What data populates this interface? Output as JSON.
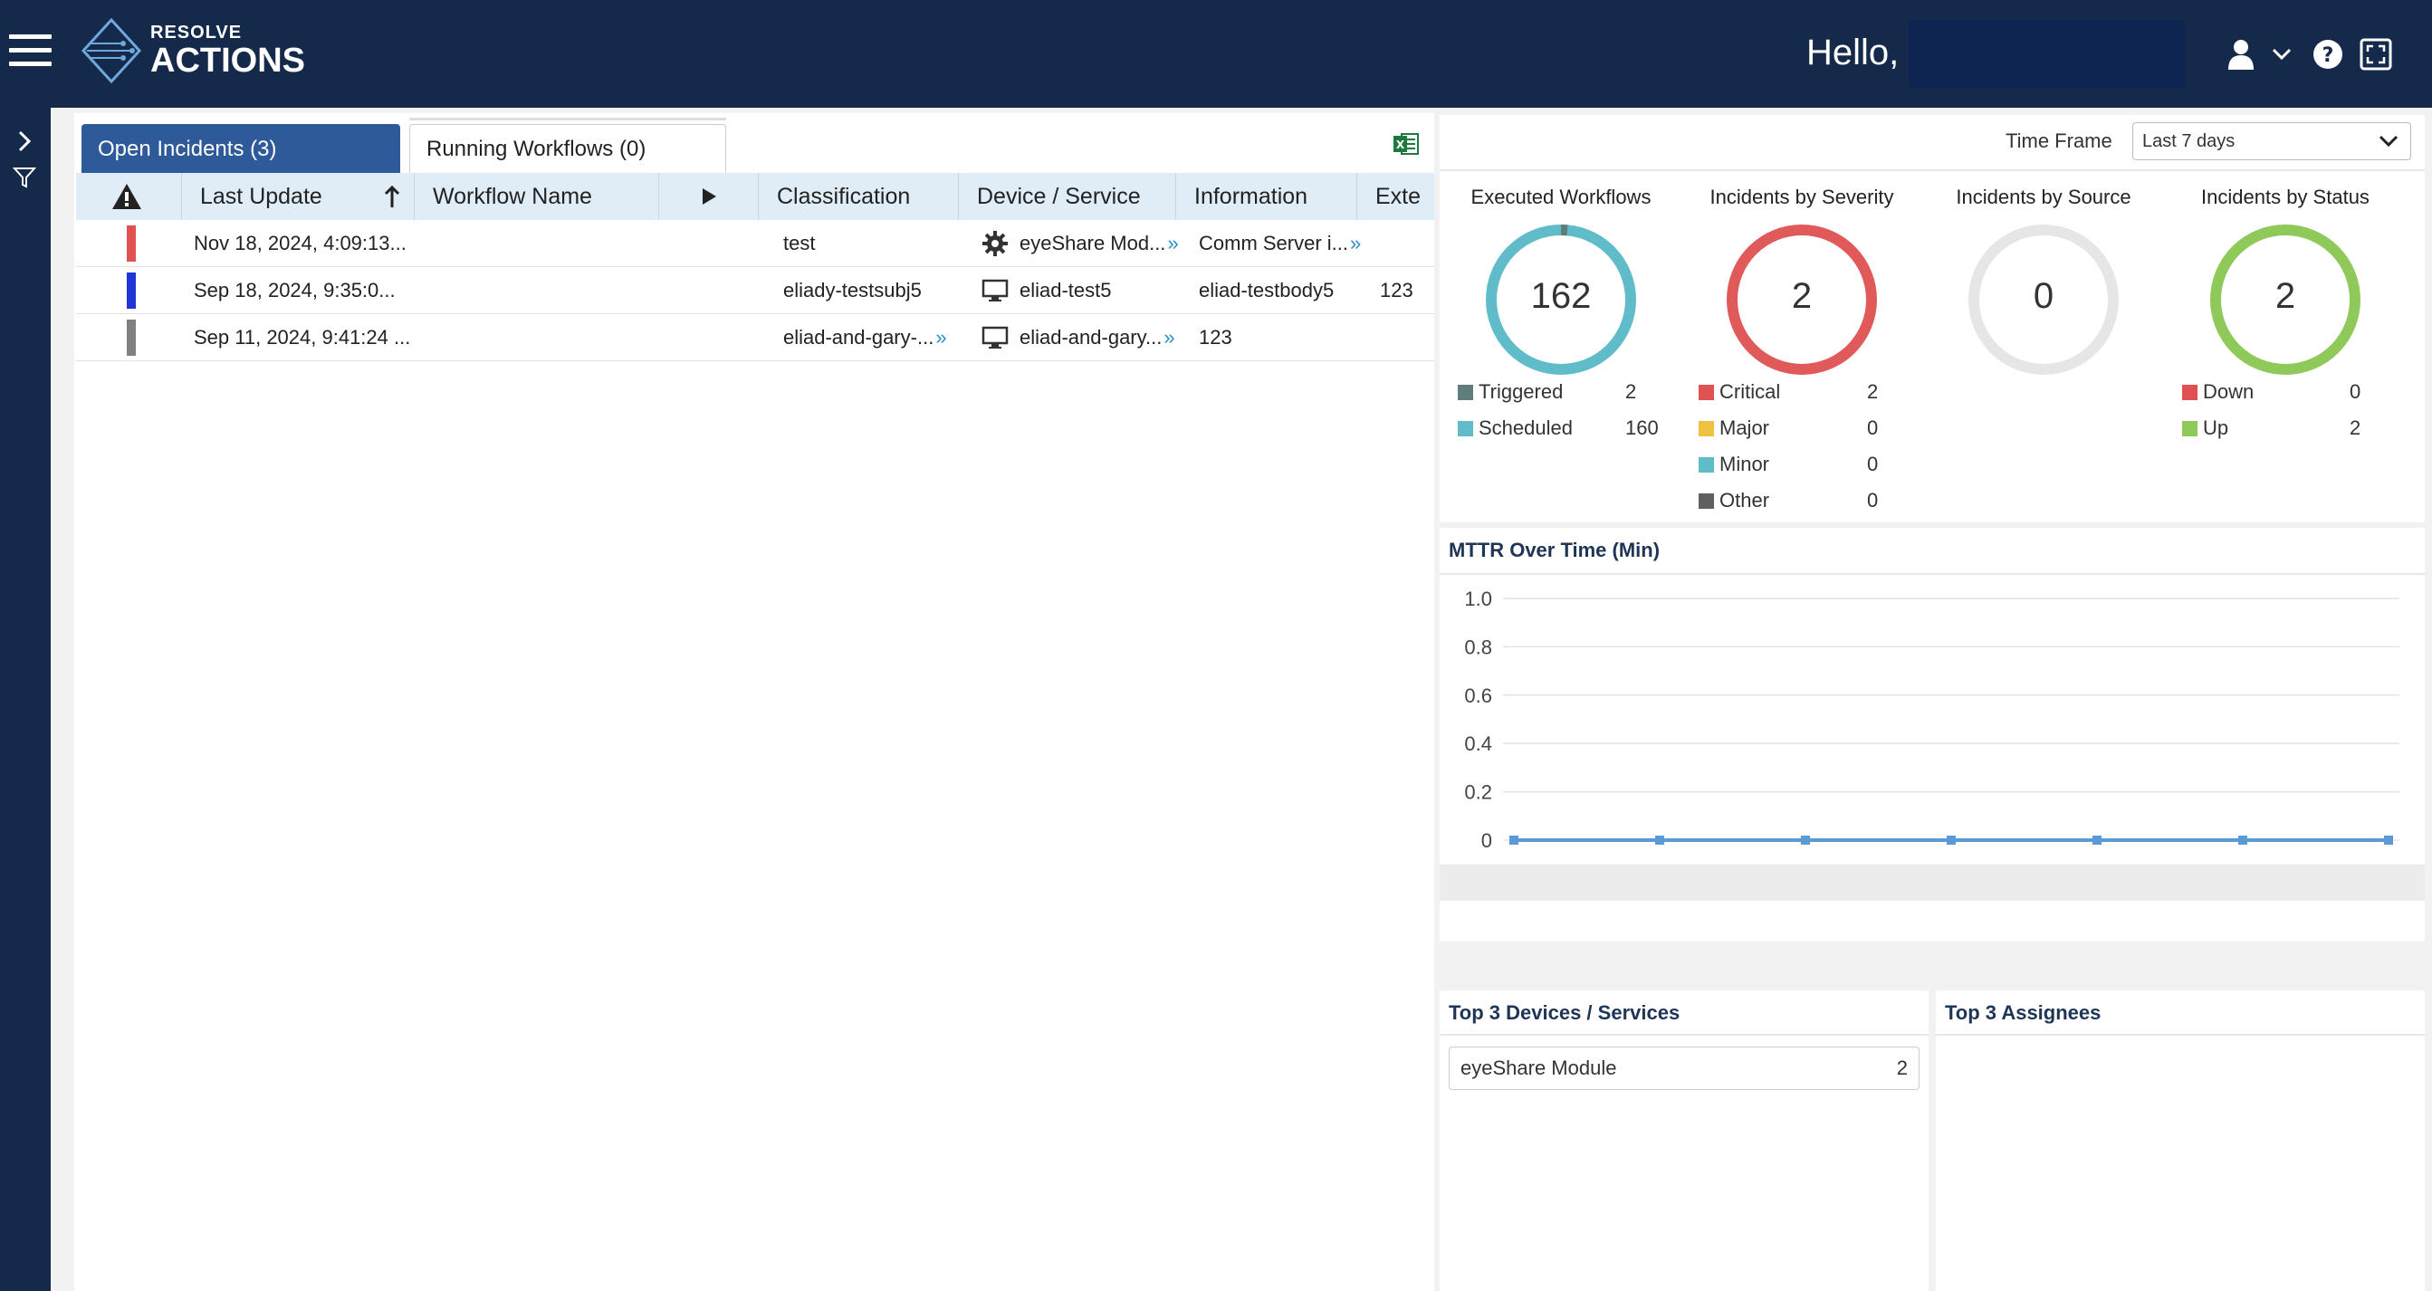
{
  "header": {
    "logo_line1": "RESOLVE",
    "logo_line2": "ACTIONS",
    "greeting": "Hello,"
  },
  "icons": {
    "menu": "hamburger-icon",
    "user": "user-icon",
    "caret": "chevron-down-icon",
    "help": "help-icon",
    "fullscreen": "fullscreen-icon",
    "expand": "chevron-right-icon",
    "filter": "filter-icon",
    "excel": "excel-icon",
    "severity": "warning-icon",
    "sort": "sort-up-icon",
    "run": "play-icon",
    "gear": "gear-icon",
    "monitor": "monitor-icon"
  },
  "tabs": {
    "open_incidents": "Open Incidents (3)",
    "running_workflows": "Running Workflows (0)"
  },
  "grid": {
    "columns": {
      "last_update": "Last Update",
      "workflow_name": "Workflow Name",
      "classification": "Classification",
      "device_service": "Device / Service",
      "information": "Information",
      "external": "Exte"
    },
    "rows": [
      {
        "severity_color": "#e05252",
        "last_update": "Nov 18, 2024, 4:09:13...",
        "workflow_name": "",
        "classification": "test",
        "device_icon": "gear-icon",
        "device": "eyeShare Mod...",
        "information": "Comm Server i...",
        "external": ""
      },
      {
        "severity_color": "#1f35d6",
        "last_update": "Sep 18, 2024, 9:35:0...",
        "workflow_name": "",
        "classification": "eliady-testsubj5",
        "device_icon": "monitor-icon",
        "device": "eliad-test5",
        "information": "eliad-testbody5",
        "external": "123"
      },
      {
        "severity_color": "#808080",
        "last_update": "Sep 11, 2024, 9:41:24 ...",
        "workflow_name": "",
        "classification": "eliad-and-gary-...",
        "device_icon": "monitor-icon",
        "device": "eliad-and-gary...",
        "information": "123",
        "external": ""
      }
    ]
  },
  "time_frame": {
    "label": "Time Frame",
    "value": "Last 7 days"
  },
  "cards": [
    {
      "title": "Executed Workflows",
      "total": "162",
      "ring_color": "#5fbcc8",
      "legend": [
        {
          "label": "Triggered",
          "value": "2",
          "color": "#607d7d"
        },
        {
          "label": "Scheduled",
          "value": "160",
          "color": "#5fbcc8"
        }
      ]
    },
    {
      "title": "Incidents by Severity",
      "total": "2",
      "ring_color": "#e05a5a",
      "legend": [
        {
          "label": "Critical",
          "value": "2",
          "color": "#e05252"
        },
        {
          "label": "Major",
          "value": "0",
          "color": "#f0c040"
        },
        {
          "label": "Minor",
          "value": "0",
          "color": "#5fbcc8"
        },
        {
          "label": "Other",
          "value": "0",
          "color": "#606060"
        }
      ]
    },
    {
      "title": "Incidents by Source",
      "total": "0",
      "ring_color": "#e6e6e6",
      "legend": []
    },
    {
      "title": "Incidents by Status",
      "total": "2",
      "ring_color": "#8ec95a",
      "legend": [
        {
          "label": "Down",
          "value": "0",
          "color": "#e05252"
        },
        {
          "label": "Up",
          "value": "2",
          "color": "#8ec95a"
        }
      ]
    }
  ],
  "mttr": {
    "title": "MTTR Over Time (Min)"
  },
  "chart_data": {
    "type": "line",
    "title": "MTTR Over Time (Min)",
    "y_ticks": [
      "1.0",
      "0.8",
      "0.6",
      "0.4",
      "0.2",
      "0"
    ],
    "ylim": [
      0,
      1
    ],
    "series": [
      {
        "values": [
          0,
          0,
          0,
          0,
          0,
          0,
          0
        ]
      }
    ],
    "grid": true,
    "line_color": "#5b9bd5"
  },
  "top_devices": {
    "title": "Top 3 Devices / Services",
    "items": [
      {
        "name": "eyeShare Module",
        "count": "2"
      }
    ]
  },
  "top_assignees": {
    "title": "Top 3 Assignees"
  }
}
